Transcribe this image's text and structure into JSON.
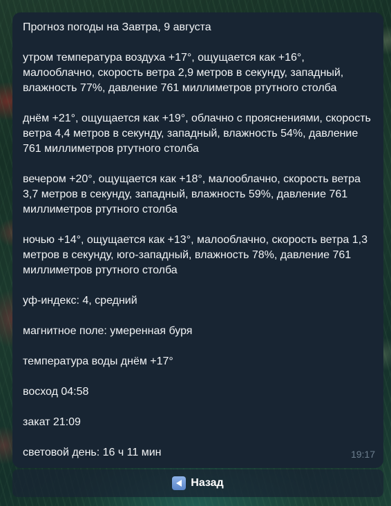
{
  "message": {
    "lines": [
      "Прогноз погоды на Завтра, 9 августа",
      "утром температура воздуха +17°, ощущается как +16°, малооблачно, скорость ветра 2,9 метров в секунду, западный, влажность 77%, давление 761 миллиметров ртутного столба",
      "днём +21°, ощущается как +19°, облачно с прояснениями, скорость ветра 4,4 метров в секунду, западный, влажность 54%, давление 761 миллиметров ртутного столба",
      "вечером +20°, ощущается как +18°, малооблачно, скорость ветра 3,7 метров в секунду, западный, влажность 59%, давление 761 миллиметров ртутного столба",
      "ночью +14°, ощущается как +13°, малооблачно, скорость ветра 1,3 метров в секунду, юго-западный, влажность 78%, давление 761 миллиметров ртутного столба",
      "уф-индекс: 4, средний",
      "магнитное поле: умеренная буря",
      "температура воды днём +17°",
      "восход 04:58",
      "закат 21:09",
      "световой день: 16 ч 11 мин"
    ],
    "time": "19:17"
  },
  "keyboard": {
    "back_icon": "back-arrow-icon",
    "back_label": "Назад"
  },
  "colors": {
    "bubble_bg": "#182533",
    "text": "#f1f3f5",
    "timestamp": "#6d7f8f",
    "icon_blue": "#6d97d6"
  }
}
